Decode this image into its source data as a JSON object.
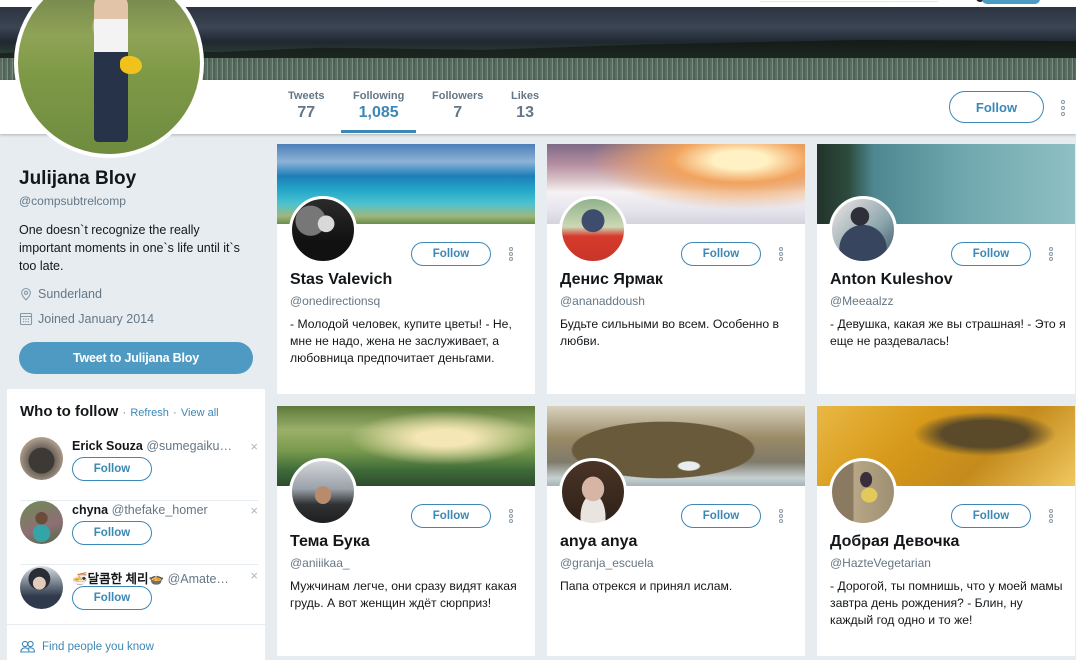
{
  "profile": {
    "name": "Julijana Bloy",
    "handle": "@compsubtrelcomp",
    "bio": "One doesn`t recognize the really important moments in one`s life until it`s too late.",
    "location": "Sunderland",
    "joined": "Joined January 2014",
    "tweet_to_label": "Tweet to Julijana Bloy",
    "follow_label": "Follow"
  },
  "stats": [
    {
      "label": "Tweets",
      "value": "77",
      "active": false
    },
    {
      "label": "Following",
      "value": "1,085",
      "active": true
    },
    {
      "label": "Followers",
      "value": "7",
      "active": false
    },
    {
      "label": "Likes",
      "value": "13",
      "active": false
    }
  ],
  "who_to_follow": {
    "title": "Who to follow",
    "refresh": "Refresh",
    "view_all": "View all",
    "separator": "·",
    "find_people": "Find people you know",
    "items": [
      {
        "name": "Erick Souza",
        "handle": "@sumegaiku…",
        "button": "Follow",
        "close": "×"
      },
      {
        "name": "chyna",
        "handle": "@thefake_homer",
        "button": "Follow",
        "close": "×"
      },
      {
        "name": "🍜달콤한 체리🍲",
        "handle": "@Amate…",
        "button": "Follow",
        "close": "×"
      }
    ]
  },
  "cards": [
    {
      "name": "Stas Valevich",
      "handle": "@onedirectionsq",
      "bio": "- Молодой человек, купите цветы! - Не, мне не надо, жена не заслуживает, а любовница предпочитает деньгами.",
      "button": "Follow"
    },
    {
      "name": "Денис Ярмак",
      "handle": "@ananaddoush",
      "bio": "Будьте сильными во всем. Особенно в любви.",
      "button": "Follow"
    },
    {
      "name": "Anton Kuleshov",
      "handle": "@Meeaalzz",
      "bio": "- Девушка, какая же вы страшная! - Это я еще не раздевалась!",
      "button": "Follow"
    },
    {
      "name": "Тема Бука",
      "handle": "@aniiikaa_",
      "bio": "Мужчинам легче, они сразу видят какая грудь. А вот женщин ждёт сюрприз!",
      "button": "Follow"
    },
    {
      "name": "anya anya",
      "handle": "@granja_escuela",
      "bio": "Папа отрекся и принял ислам.",
      "button": "Follow"
    },
    {
      "name": "Добрая Девочка",
      "handle": "@HazteVegetarian",
      "bio": "- Дорогой, ты помнишь, что у моей мамы завтра день рождения? - Блин, ну каждый год одно и то же!",
      "button": "Follow"
    }
  ],
  "colors": {
    "accent": "#3b88b5",
    "tweet_button": "#4f9ac2",
    "page_bg": "#e6ecf0",
    "muted_text": "#657786"
  }
}
